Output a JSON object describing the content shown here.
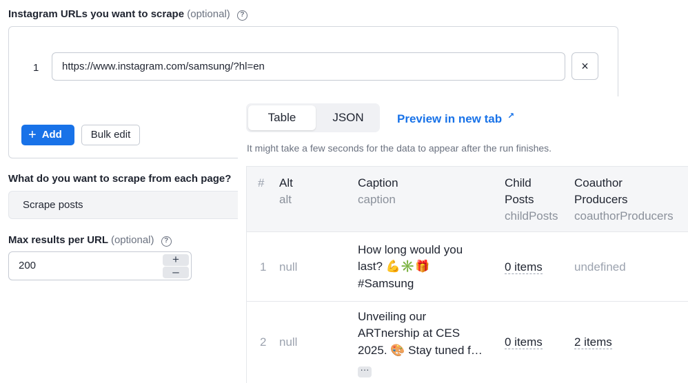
{
  "form": {
    "urls_label": "Instagram URLs you want to scrape",
    "optional": "(optional)",
    "urls": [
      {
        "index": "1",
        "value": "https://www.instagram.com/samsung/?hl=en"
      }
    ],
    "clear_label": "×",
    "add_label": "Add",
    "bulk_edit_label": "Bulk edit",
    "scrape_label": "What do you want to scrape from each page?",
    "scrape_value": "Scrape posts",
    "max_label": "Max results per URL",
    "max_value": "200",
    "help_glyph": "?"
  },
  "panel": {
    "tabs": [
      {
        "label": "Table"
      },
      {
        "label": "JSON"
      }
    ],
    "active_tab": "Table",
    "preview_label": "Preview in new tab",
    "preview_glyph": "↗",
    "hint": "It might take a few seconds for the data to appear after the run finishes."
  },
  "table": {
    "columns": [
      {
        "title": "#",
        "key": ""
      },
      {
        "title": "Alt",
        "key": "alt"
      },
      {
        "title": "Caption",
        "key": "caption"
      },
      {
        "title_lines": [
          "Child",
          "Posts"
        ],
        "key": "childPosts"
      },
      {
        "title_lines": [
          "Coauthor",
          "Producers"
        ],
        "key": "coauthorProducers"
      }
    ],
    "rows": [
      {
        "num": "1",
        "alt": "null",
        "caption_lines": [
          "How long would you",
          "last? 💪✳️🎁",
          "#Samsung"
        ],
        "child_posts": "0 items",
        "coauthor_producers": "undefined"
      },
      {
        "num": "2",
        "alt": "null",
        "caption_lines": [
          "Unveiling our",
          "ARTnership at CES",
          "2025. 🎨 Stay tuned f…"
        ],
        "more": "···",
        "child_posts": "0 items",
        "coauthor_producers": "2 items"
      }
    ]
  }
}
